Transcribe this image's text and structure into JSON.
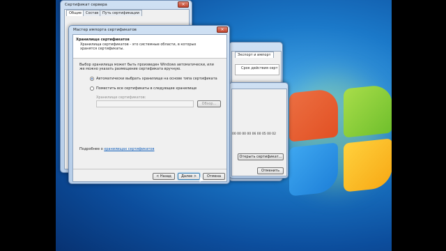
{
  "cert_window": {
    "title": "Сертификат сервера",
    "tabs": [
      "Общие",
      "Состав",
      "Путь сертификации"
    ]
  },
  "middle_window": {
    "tab": "Экспорт и импорт",
    "column_header": "Срок действия серт",
    "hex_value": "00 00 00 00 06 00 05 00 02",
    "open_button": "Открыть сертификат...",
    "cancel_button": "Отменить"
  },
  "wizard": {
    "title": "Мастер импорта сертификатов",
    "header_title": "Хранилище сертификатов",
    "header_desc": "Хранилища сертификатов - это системные области, в которых хранятся сертификаты.",
    "body_text": "Выбор хранилища может быть произведен Windows автоматически, или же можно указать размещение сертификата вручную.",
    "radio_auto": "Автоматически выбрать хранилище на основе типа сертификата",
    "radio_manual": "Поместить все сертификаты в следующее хранилище",
    "store_label": "Хранилище сертификатов:",
    "browse_button": "Обзор...",
    "more_prefix": "Подробнее о",
    "more_link": "хранилищах сертификатов",
    "back_button": "< Назад",
    "next_button": "Далее >",
    "cancel_button": "Отмена"
  },
  "colors": {
    "wizard_header": "#ffffff",
    "link": "#0d5cba",
    "desktop": "#1b79c9"
  }
}
